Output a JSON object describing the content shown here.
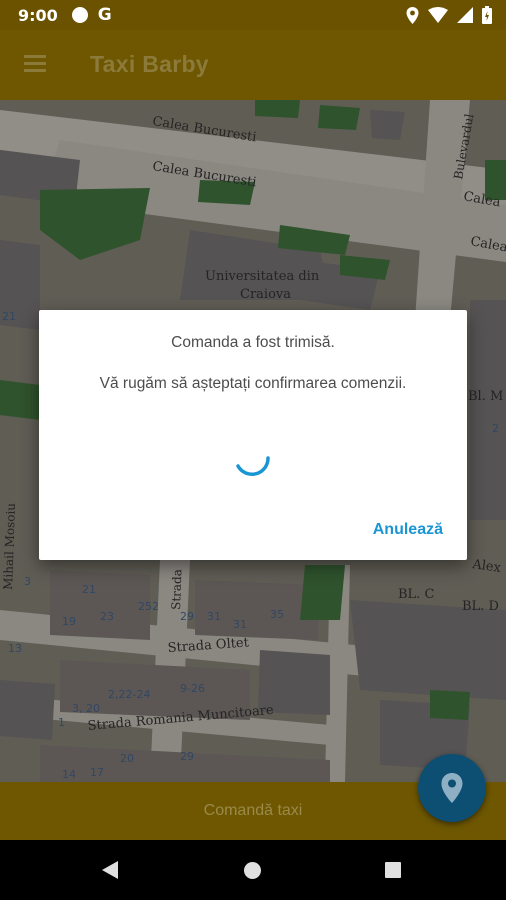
{
  "status_bar": {
    "time": "9:00",
    "google_letter": "G",
    "icons": [
      "circle-notification-icon",
      "google-icon",
      "location-icon",
      "wifi-icon",
      "signal-icon",
      "battery-icon"
    ]
  },
  "toolbar": {
    "title": "Taxi Barby",
    "menu_icon": "hamburger-menu-icon"
  },
  "map": {
    "labels": {
      "calea1": "Calea Bucuresti",
      "calea2": "Calea Bucuresti",
      "bulevardul": "Bulevardul",
      "calea_r1": "Calea",
      "calea_r2": "Calea",
      "univ1": "Universitatea din",
      "univ2": "Craiova",
      "bl_m": "Bl. M",
      "bl_c": "BL. C",
      "bl_d": "BL. D",
      "alex": "Alex",
      "mosoiu": "Mihail Mosoiu",
      "strada_v": "Strada",
      "oltet": "Strada Oltet",
      "romania": "Strada Romania Muncitoare",
      "n21": "21",
      "n23": "23",
      "n252": "252",
      "n31a": "31",
      "n31b": "31",
      "n35": "35",
      "n29": "29",
      "n19": "19",
      "n13": "13",
      "n3": "3",
      "n1": "1",
      "n2": "2",
      "n21b": "21",
      "n9_26": "9-26",
      "n22_24": "2,22-24",
      "n3_20": "3, 20",
      "n20": "20",
      "n14": "14",
      "n29b": "29",
      "n17": "17"
    },
    "building_color": "#9e9a8f",
    "street_color": "#bdbab3",
    "green_color": "#3d6b3a"
  },
  "dialog": {
    "title": "Comanda a fost trimisă.",
    "message": "Vă rugăm să așteptați confirmarea comenzii.",
    "cancel_label": "Anulează",
    "accent_color": "#1b96d4"
  },
  "bottom": {
    "order_label": "Comandă taxi",
    "fab_icon": "location-pin-icon"
  },
  "nav_bar": {
    "icons": [
      "back-icon",
      "home-icon",
      "recent-apps-icon"
    ]
  }
}
